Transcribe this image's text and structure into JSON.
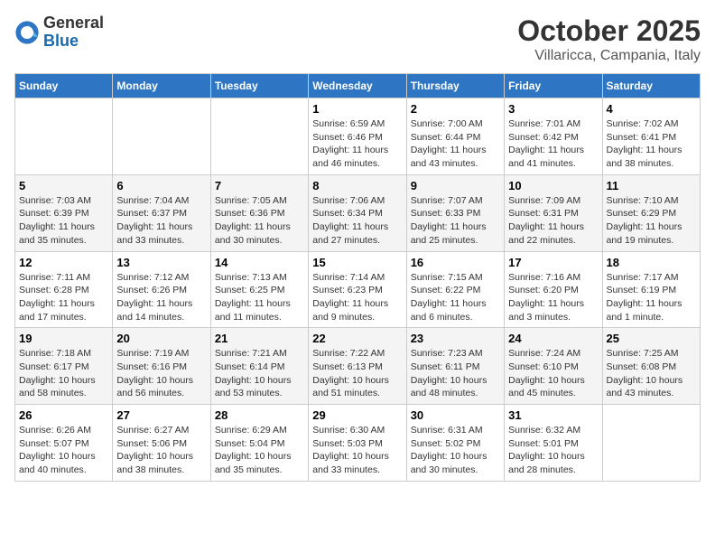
{
  "logo": {
    "general": "General",
    "blue": "Blue"
  },
  "header": {
    "month": "October 2025",
    "location": "Villaricca, Campania, Italy"
  },
  "days_of_week": [
    "Sunday",
    "Monday",
    "Tuesday",
    "Wednesday",
    "Thursday",
    "Friday",
    "Saturday"
  ],
  "weeks": [
    {
      "days": [
        {
          "num": "",
          "content": ""
        },
        {
          "num": "",
          "content": ""
        },
        {
          "num": "",
          "content": ""
        },
        {
          "num": "1",
          "content": "Sunrise: 6:59 AM\nSunset: 6:46 PM\nDaylight: 11 hours\nand 46 minutes."
        },
        {
          "num": "2",
          "content": "Sunrise: 7:00 AM\nSunset: 6:44 PM\nDaylight: 11 hours\nand 43 minutes."
        },
        {
          "num": "3",
          "content": "Sunrise: 7:01 AM\nSunset: 6:42 PM\nDaylight: 11 hours\nand 41 minutes."
        },
        {
          "num": "4",
          "content": "Sunrise: 7:02 AM\nSunset: 6:41 PM\nDaylight: 11 hours\nand 38 minutes."
        }
      ]
    },
    {
      "days": [
        {
          "num": "5",
          "content": "Sunrise: 7:03 AM\nSunset: 6:39 PM\nDaylight: 11 hours\nand 35 minutes."
        },
        {
          "num": "6",
          "content": "Sunrise: 7:04 AM\nSunset: 6:37 PM\nDaylight: 11 hours\nand 33 minutes."
        },
        {
          "num": "7",
          "content": "Sunrise: 7:05 AM\nSunset: 6:36 PM\nDaylight: 11 hours\nand 30 minutes."
        },
        {
          "num": "8",
          "content": "Sunrise: 7:06 AM\nSunset: 6:34 PM\nDaylight: 11 hours\nand 27 minutes."
        },
        {
          "num": "9",
          "content": "Sunrise: 7:07 AM\nSunset: 6:33 PM\nDaylight: 11 hours\nand 25 minutes."
        },
        {
          "num": "10",
          "content": "Sunrise: 7:09 AM\nSunset: 6:31 PM\nDaylight: 11 hours\nand 22 minutes."
        },
        {
          "num": "11",
          "content": "Sunrise: 7:10 AM\nSunset: 6:29 PM\nDaylight: 11 hours\nand 19 minutes."
        }
      ]
    },
    {
      "days": [
        {
          "num": "12",
          "content": "Sunrise: 7:11 AM\nSunset: 6:28 PM\nDaylight: 11 hours\nand 17 minutes."
        },
        {
          "num": "13",
          "content": "Sunrise: 7:12 AM\nSunset: 6:26 PM\nDaylight: 11 hours\nand 14 minutes."
        },
        {
          "num": "14",
          "content": "Sunrise: 7:13 AM\nSunset: 6:25 PM\nDaylight: 11 hours\nand 11 minutes."
        },
        {
          "num": "15",
          "content": "Sunrise: 7:14 AM\nSunset: 6:23 PM\nDaylight: 11 hours\nand 9 minutes."
        },
        {
          "num": "16",
          "content": "Sunrise: 7:15 AM\nSunset: 6:22 PM\nDaylight: 11 hours\nand 6 minutes."
        },
        {
          "num": "17",
          "content": "Sunrise: 7:16 AM\nSunset: 6:20 PM\nDaylight: 11 hours\nand 3 minutes."
        },
        {
          "num": "18",
          "content": "Sunrise: 7:17 AM\nSunset: 6:19 PM\nDaylight: 11 hours\nand 1 minute."
        }
      ]
    },
    {
      "days": [
        {
          "num": "19",
          "content": "Sunrise: 7:18 AM\nSunset: 6:17 PM\nDaylight: 10 hours\nand 58 minutes."
        },
        {
          "num": "20",
          "content": "Sunrise: 7:19 AM\nSunset: 6:16 PM\nDaylight: 10 hours\nand 56 minutes."
        },
        {
          "num": "21",
          "content": "Sunrise: 7:21 AM\nSunset: 6:14 PM\nDaylight: 10 hours\nand 53 minutes."
        },
        {
          "num": "22",
          "content": "Sunrise: 7:22 AM\nSunset: 6:13 PM\nDaylight: 10 hours\nand 51 minutes."
        },
        {
          "num": "23",
          "content": "Sunrise: 7:23 AM\nSunset: 6:11 PM\nDaylight: 10 hours\nand 48 minutes."
        },
        {
          "num": "24",
          "content": "Sunrise: 7:24 AM\nSunset: 6:10 PM\nDaylight: 10 hours\nand 45 minutes."
        },
        {
          "num": "25",
          "content": "Sunrise: 7:25 AM\nSunset: 6:08 PM\nDaylight: 10 hours\nand 43 minutes."
        }
      ]
    },
    {
      "days": [
        {
          "num": "26",
          "content": "Sunrise: 6:26 AM\nSunset: 5:07 PM\nDaylight: 10 hours\nand 40 minutes."
        },
        {
          "num": "27",
          "content": "Sunrise: 6:27 AM\nSunset: 5:06 PM\nDaylight: 10 hours\nand 38 minutes."
        },
        {
          "num": "28",
          "content": "Sunrise: 6:29 AM\nSunset: 5:04 PM\nDaylight: 10 hours\nand 35 minutes."
        },
        {
          "num": "29",
          "content": "Sunrise: 6:30 AM\nSunset: 5:03 PM\nDaylight: 10 hours\nand 33 minutes."
        },
        {
          "num": "30",
          "content": "Sunrise: 6:31 AM\nSunset: 5:02 PM\nDaylight: 10 hours\nand 30 minutes."
        },
        {
          "num": "31",
          "content": "Sunrise: 6:32 AM\nSunset: 5:01 PM\nDaylight: 10 hours\nand 28 minutes."
        },
        {
          "num": "",
          "content": ""
        }
      ]
    }
  ]
}
